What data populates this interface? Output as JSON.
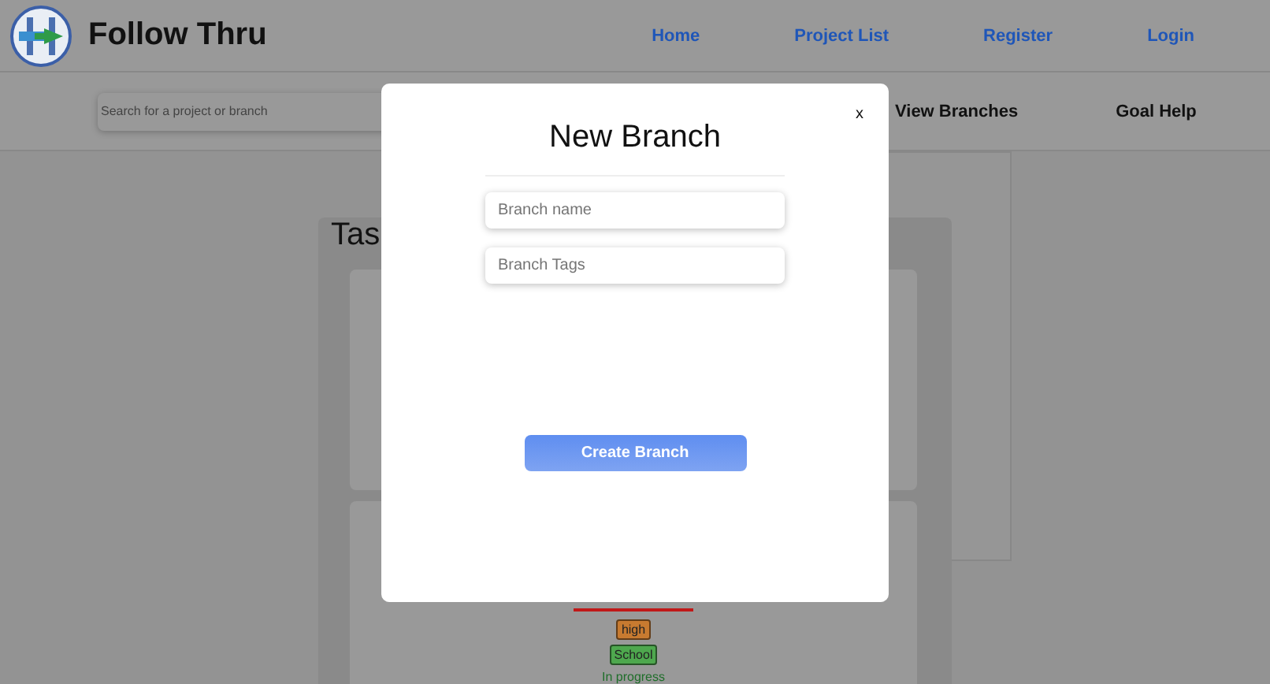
{
  "header": {
    "brand": "Follow Thru",
    "nav": [
      {
        "label": "Home"
      },
      {
        "label": "Project List"
      },
      {
        "label": "Register"
      },
      {
        "label": "Login"
      }
    ]
  },
  "subbar": {
    "search": {
      "placeholder": "Search for a project or branch"
    },
    "links": [
      {
        "label": "View Branches"
      },
      {
        "label": "Goal Help"
      }
    ]
  },
  "board": {
    "title": "Tas",
    "tags": [
      {
        "label": "high",
        "color": "#c77a30"
      },
      {
        "label": "School",
        "color": "#4ea84e"
      }
    ],
    "status": "In progress"
  },
  "modal": {
    "title": "New Branch",
    "close": "x",
    "fields": [
      {
        "placeholder": "Branch name"
      },
      {
        "placeholder": "Branch Tags"
      }
    ],
    "button": "Create Branch"
  }
}
